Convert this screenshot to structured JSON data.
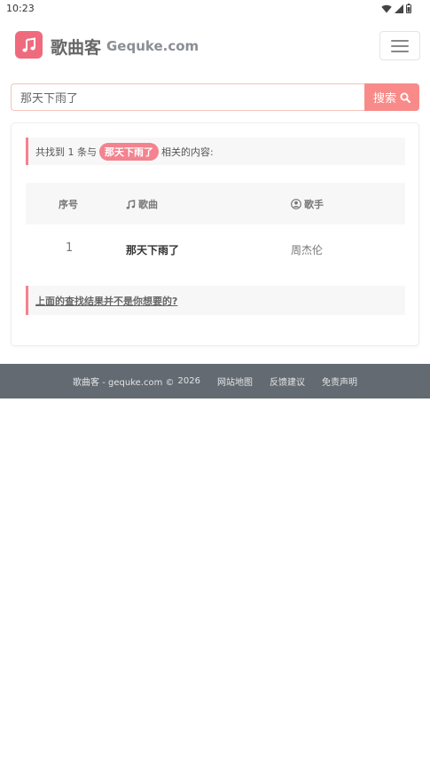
{
  "status_bar": {
    "time": "10:23",
    "icons": [
      "wifi-icon",
      "signal-icon",
      "battery-icon"
    ]
  },
  "navbar": {
    "brand_name": "歌曲客",
    "brand_domain": "Gequke.com",
    "logo_icon": "music-note-icon",
    "menu_icon": "hamburger-menu-icon"
  },
  "search": {
    "value": "那天下雨了",
    "button_label": "搜索",
    "button_icon": "search-icon"
  },
  "results": {
    "prefix": "共找到 1 条与",
    "keyword": "那天下雨了",
    "suffix": "相关的内容:",
    "columns": {
      "index": "序号",
      "song": "歌曲",
      "singer": "歌手"
    },
    "rows": [
      {
        "index": "1",
        "song": "那天下雨了",
        "singer": "周杰伦"
      }
    ],
    "feedback_link": "上面的查找结果并不是你想要的?"
  },
  "footer": {
    "copyright": "歌曲客 - gequke.com ©",
    "year": "2026",
    "links": [
      "网站地图",
      "反馈建议",
      "免责声明"
    ]
  },
  "colors": {
    "accent": "#f3838f",
    "search_button": "#f88b89",
    "footer_bg": "#636a71"
  }
}
